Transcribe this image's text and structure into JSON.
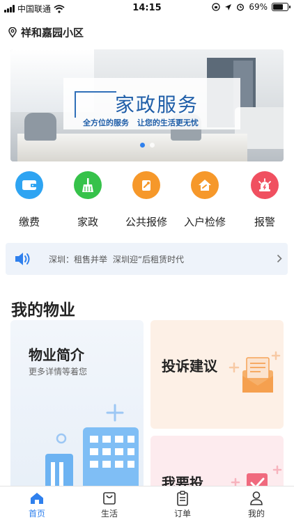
{
  "status_bar": {
    "carrier": "中国联通",
    "time": "14:15",
    "battery": "69%",
    "battery_level": 0.69
  },
  "location": {
    "name": "祥和嘉园小区"
  },
  "banner": {
    "title": "家政服务",
    "subtitle": "全方位的服务 让您的生活更无忧",
    "slide_count": 2,
    "active_slide": 1
  },
  "services": [
    {
      "label": "缴费",
      "icon": "wallet-icon",
      "color": "#2ea4f2"
    },
    {
      "label": "家政",
      "icon": "broom-icon",
      "color": "#36c24a"
    },
    {
      "label": "公共报修",
      "icon": "wrench-icon",
      "color": "#f6982a"
    },
    {
      "label": "入户检修",
      "icon": "home-repair-icon",
      "color": "#f6982a"
    },
    {
      "label": "报警",
      "icon": "alarm-icon",
      "color": "#f05060"
    }
  ],
  "notice": {
    "text": "深圳：租售并举 深圳迎“后租赁时代",
    "icon": "speaker-icon"
  },
  "section": {
    "title": "我的物业"
  },
  "cards": {
    "intro": {
      "title": "物业简介",
      "subtitle": "更多详情等着您"
    },
    "complaint": {
      "title": "投诉建议"
    },
    "report": {
      "title": "我要投"
    }
  },
  "tabbar": {
    "items": [
      {
        "label": "首页",
        "icon": "home-icon",
        "active": true
      },
      {
        "label": "生活",
        "icon": "bag-icon",
        "active": false
      },
      {
        "label": "订单",
        "icon": "clipboard-icon",
        "active": false
      },
      {
        "label": "我的",
        "icon": "user-icon",
        "active": false
      }
    ]
  },
  "colors": {
    "accent": "#2f80ed",
    "banner_title": "#1f5ea8"
  }
}
